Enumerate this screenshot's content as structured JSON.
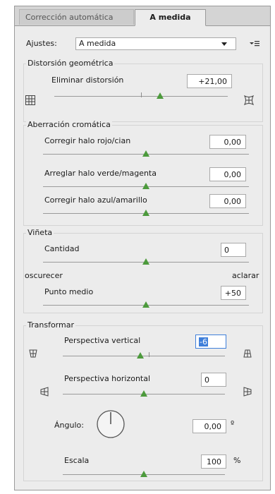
{
  "tabs": {
    "auto": "Corrección automática",
    "custom": "A medida"
  },
  "settings": {
    "label": "Ajustes:",
    "value": "A medida"
  },
  "geometric": {
    "title": "Distorsión geométrica",
    "remove_distortion_label": "Eliminar distorsión",
    "remove_distortion_value": "+21,00",
    "remove_distortion_level": 0.6
  },
  "chromatic": {
    "title": "Aberración cromática",
    "red_cyan_label": "Corregir halo rojo/cian",
    "red_cyan_value": "0,00",
    "green_magenta_label": "Arreglar halo verde/magenta",
    "green_magenta_value": "0,00",
    "blue_yellow_label": "Corregir halo azul/amarillo",
    "blue_yellow_value": "0,00"
  },
  "vignette": {
    "title": "Viñeta",
    "amount_label": "Cantidad",
    "amount_value": "0",
    "darken_label": "oscurecer",
    "lighten_label": "aclarar",
    "midpoint_label": "Punto medio",
    "midpoint_value": "+50"
  },
  "transform": {
    "title": "Transformar",
    "vertical_label": "Perspectiva vertical",
    "vertical_value": "-6",
    "horizontal_label": "Perspectiva horizontal",
    "horizontal_value": "0",
    "angle_label": "Ángulo:",
    "angle_value": "0,00",
    "angle_unit": "º",
    "scale_label": "Escala",
    "scale_value": "100",
    "scale_unit": "%"
  }
}
